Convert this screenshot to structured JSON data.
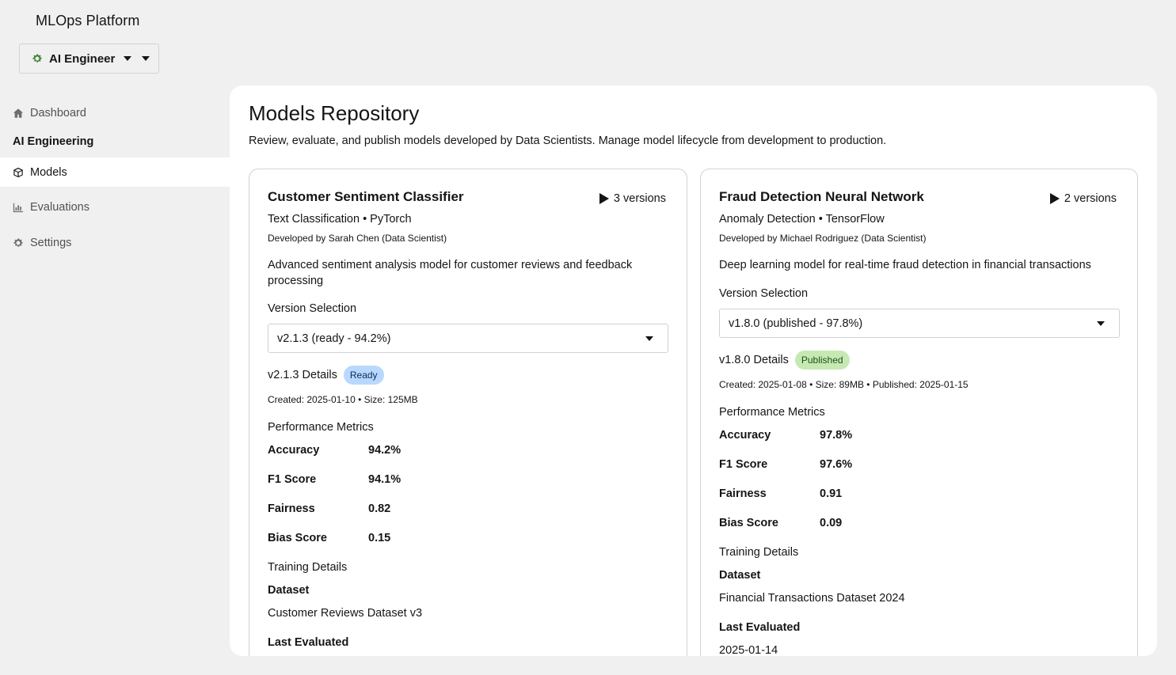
{
  "app": {
    "title": "MLOps Platform"
  },
  "role_switcher": {
    "label": "AI Engineer"
  },
  "sidebar": {
    "items": [
      {
        "label": "Dashboard"
      },
      {
        "label": "Models"
      },
      {
        "label": "Evaluations"
      },
      {
        "label": "Settings"
      }
    ],
    "group_label": "AI Engineering"
  },
  "page": {
    "title": "Models Repository",
    "description": "Review, evaluate, and publish models developed by Data Scientists. Manage model lifecycle from development to production."
  },
  "common": {
    "version_selection_label": "Version Selection",
    "performance_metrics_label": "Performance Metrics",
    "training_details_label": "Training Details",
    "dataset_label": "Dataset",
    "last_evaluated_label": "Last Evaluated"
  },
  "models": [
    {
      "name": "Customer Sentiment Classifier",
      "versions": "3 versions",
      "type": "Text Classification • PyTorch",
      "developer": "Developed by Sarah Chen (Data Scientist)",
      "description": "Advanced sentiment analysis model for customer reviews and feedback processing",
      "selected_version": "v2.1.3 (ready - 94.2%)",
      "details_label": "v2.1.3 Details",
      "status": "Ready",
      "meta": "Created: 2025-01-10 • Size: 125MB",
      "metrics": [
        {
          "name": "Accuracy",
          "value": "94.2%"
        },
        {
          "name": "F1 Score",
          "value": "94.1%"
        },
        {
          "name": "Fairness",
          "value": "0.82"
        },
        {
          "name": "Bias Score",
          "value": "0.15"
        }
      ],
      "dataset": "Customer Reviews Dataset v3",
      "last_evaluated": ""
    },
    {
      "name": "Fraud Detection Neural Network",
      "versions": "2 versions",
      "type": "Anomaly Detection • TensorFlow",
      "developer": "Developed by Michael Rodriguez (Data Scientist)",
      "description": "Deep learning model for real-time fraud detection in financial transactions",
      "selected_version": "v1.8.0 (published - 97.8%)",
      "details_label": "v1.8.0 Details",
      "status": "Published",
      "meta": "Created: 2025-01-08 • Size: 89MB • Published: 2025-01-15",
      "metrics": [
        {
          "name": "Accuracy",
          "value": "97.8%"
        },
        {
          "name": "F1 Score",
          "value": "97.6%"
        },
        {
          "name": "Fairness",
          "value": "0.91"
        },
        {
          "name": "Bias Score",
          "value": "0.09"
        }
      ],
      "dataset": "Financial Transactions Dataset 2024",
      "last_evaluated": "2025-01-14"
    }
  ]
}
